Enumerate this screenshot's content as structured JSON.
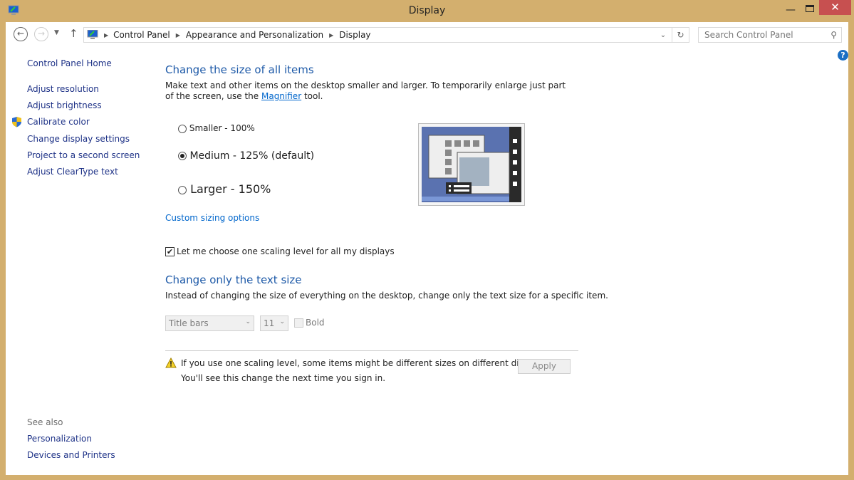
{
  "window": {
    "title": "Display",
    "accent": "#d3af6e",
    "close_color": "#c75050"
  },
  "nav": {
    "breadcrumb": [
      "Control Panel",
      "Appearance and Personalization",
      "Display"
    ],
    "search_placeholder": "Search Control Panel"
  },
  "sidebar": {
    "home": "Control Panel Home",
    "items": [
      "Adjust resolution",
      "Adjust brightness",
      "Calibrate color",
      "Change display settings",
      "Project to a second screen",
      "Adjust ClearType text"
    ],
    "see_also_label": "See also",
    "see_also": [
      "Personalization",
      "Devices and Printers"
    ]
  },
  "main": {
    "heading1": "Change the size of all items",
    "desc_part1": "Make text and other items on the desktop smaller and larger. To temporarily enlarge just part of the screen, use the ",
    "magnifier": "Magnifier",
    "desc_part2": " tool.",
    "options": [
      {
        "label": "Smaller - 100%",
        "selected": false
      },
      {
        "label": "Medium - 125% (default)",
        "selected": true
      },
      {
        "label": "Larger - 150%",
        "selected": false
      }
    ],
    "custom_sizing": "Custom sizing options",
    "checkbox_label": "Let me choose one scaling level for all my displays",
    "checkbox_checked": true,
    "heading2": "Change only the text size",
    "desc2": "Instead of changing the size of everything on the desktop, change only the text size for a specific item.",
    "item_select": "Title bars",
    "size_select": "11",
    "bold_label": "Bold",
    "warning1": "If you use one scaling level, some items might be different sizes on different displays.",
    "warning2": "You'll see this change the next time you sign in.",
    "apply": "Apply"
  }
}
